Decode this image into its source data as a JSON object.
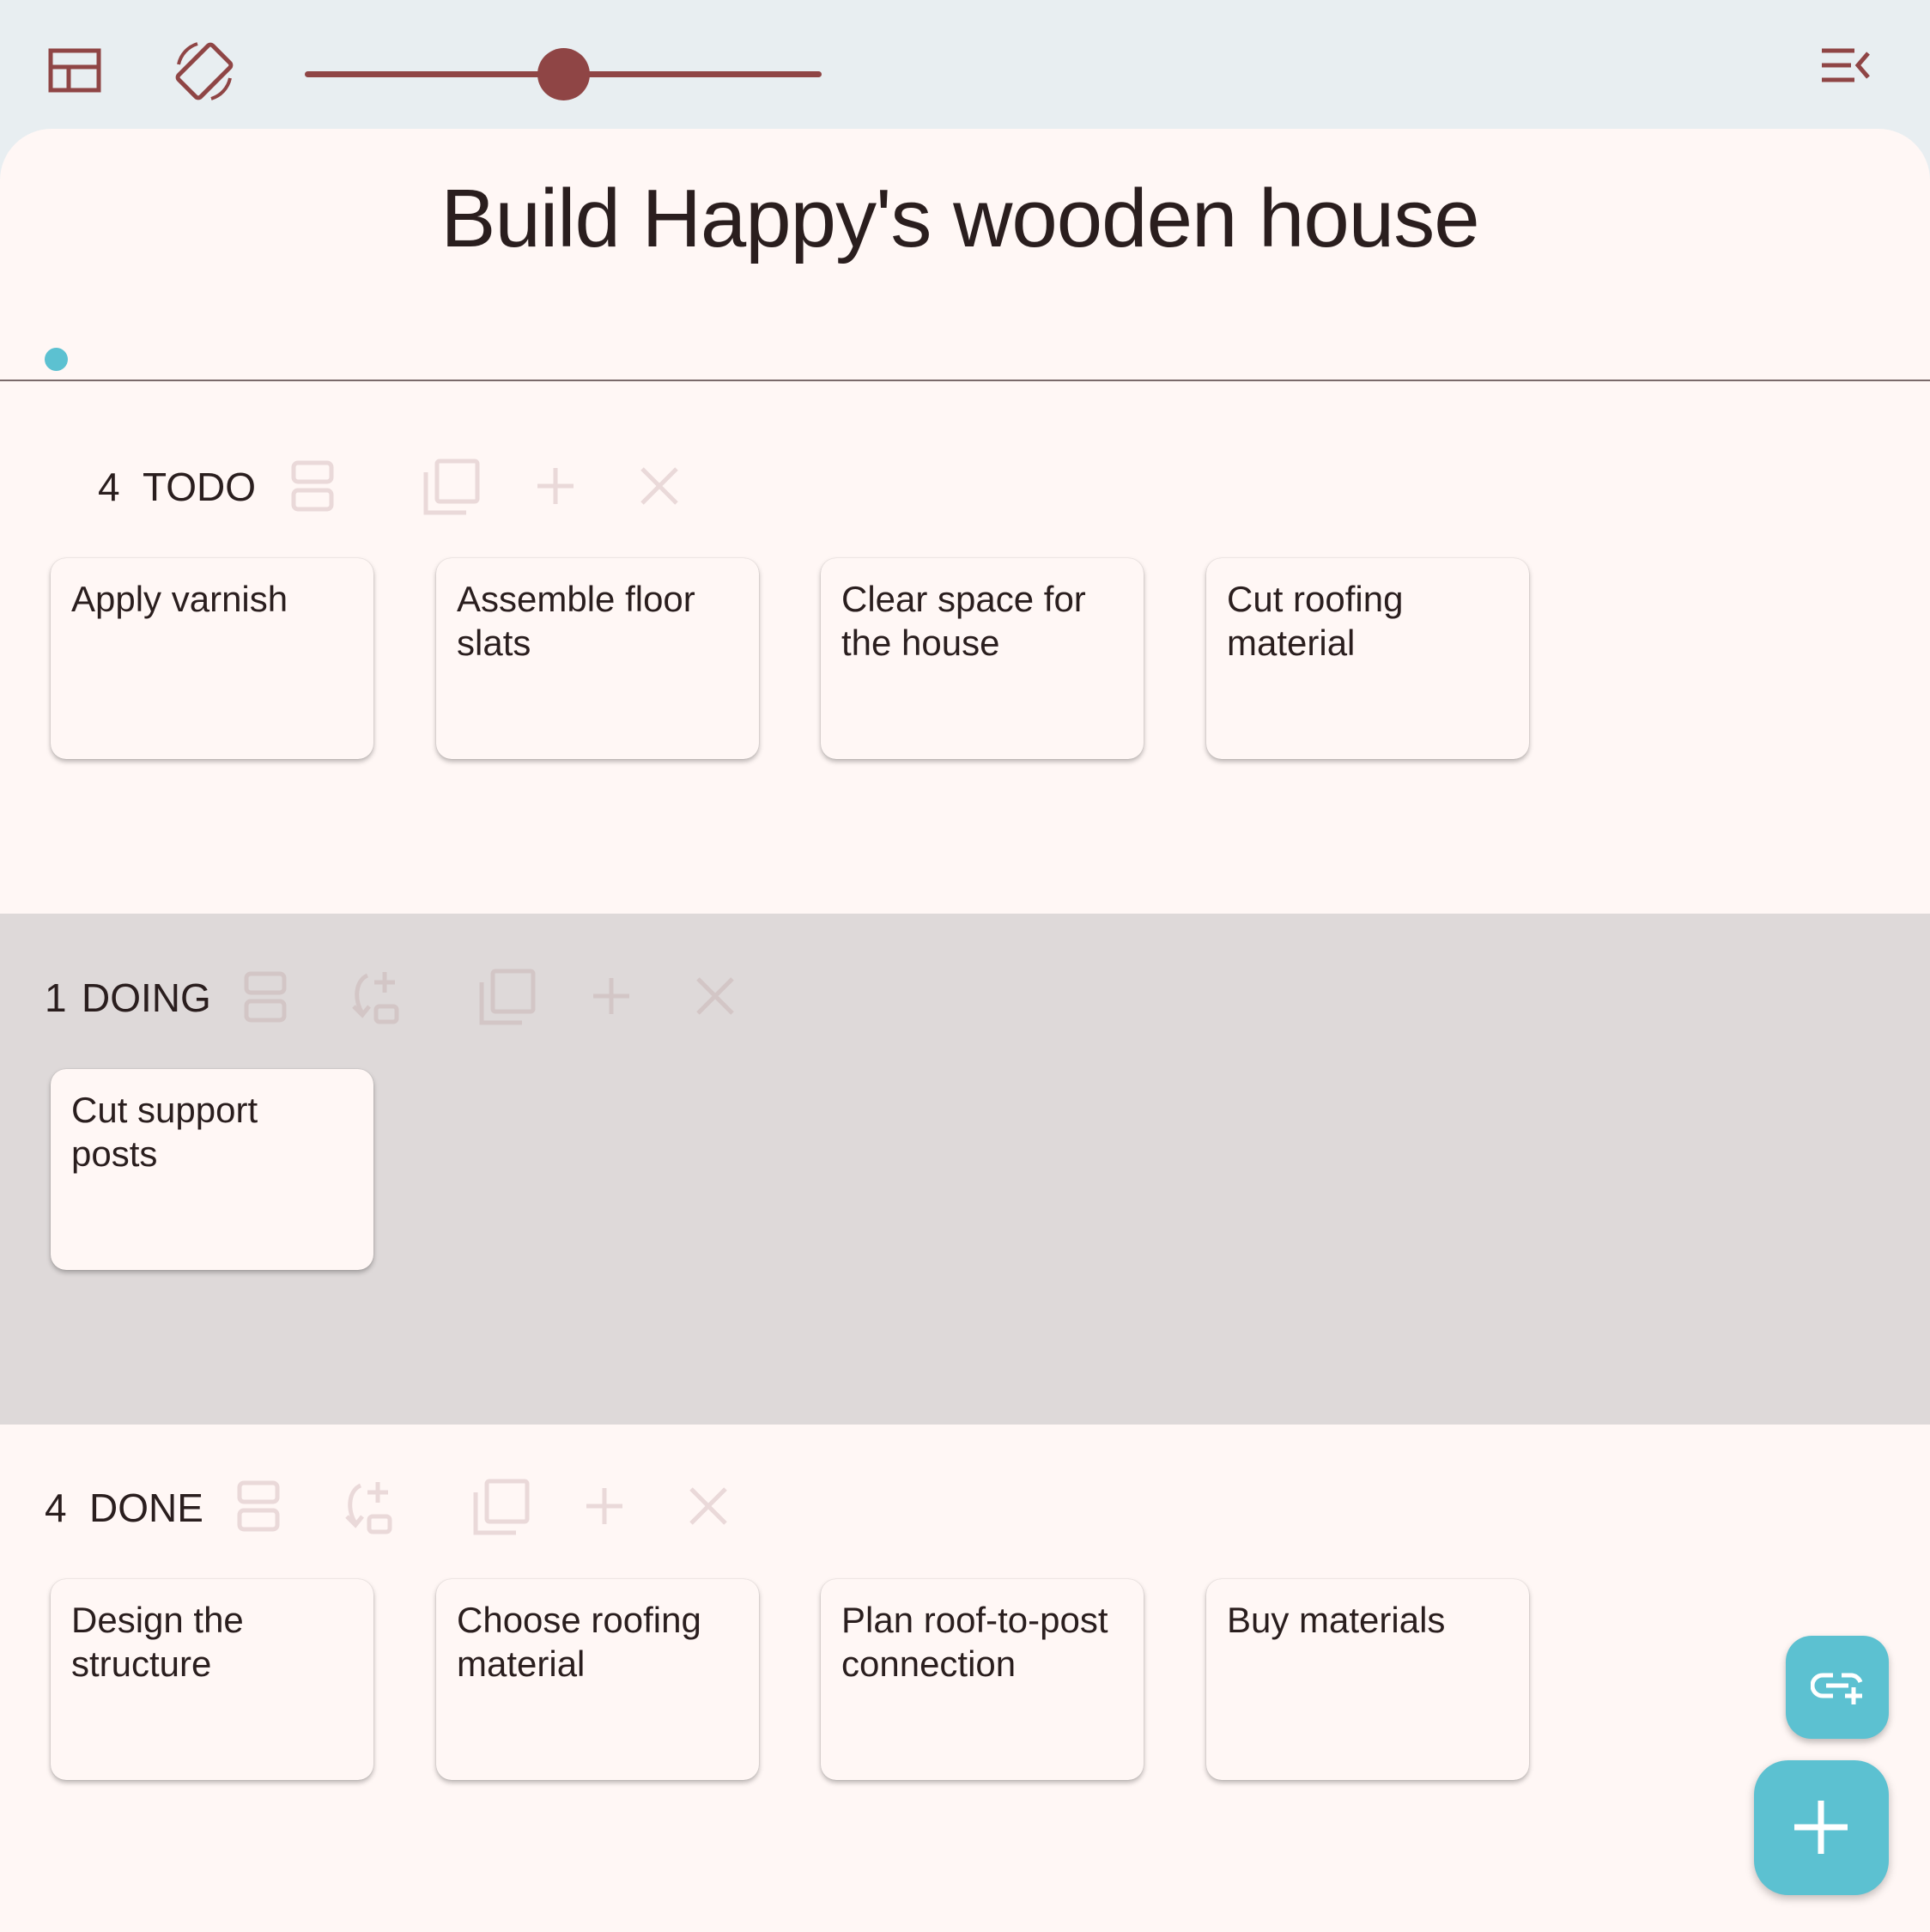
{
  "toolbar": {
    "icons": [
      "board-layout-icon",
      "screen-rotation-icon",
      "menu-collapse-icon"
    ],
    "zoom_level": 0.5
  },
  "board": {
    "title": "Build Happy's wooden house"
  },
  "sections": {
    "todo": {
      "count": "4",
      "name": "TODO",
      "indicator_color": "#5cc1d1",
      "cards": [
        "Apply varnish",
        "Assemble floor slats",
        "Clear space for the house",
        "Cut roofing material"
      ]
    },
    "doing": {
      "count": "1",
      "name": "DOING",
      "cards": [
        "Cut support posts"
      ]
    },
    "done": {
      "count": "4",
      "name": "DONE",
      "cards": [
        "Design the structure",
        "Choose roofing material",
        "Plan roof-to-post connection",
        "Buy materials"
      ]
    }
  },
  "colors": {
    "accent": "#8f4545",
    "fab": "#5cc1d1",
    "sheet": "#fff7f5",
    "doing_background": "#ded9d9",
    "topbar": "#e8eef1"
  },
  "fabs": [
    "add-link-icon",
    "plus-icon"
  ]
}
